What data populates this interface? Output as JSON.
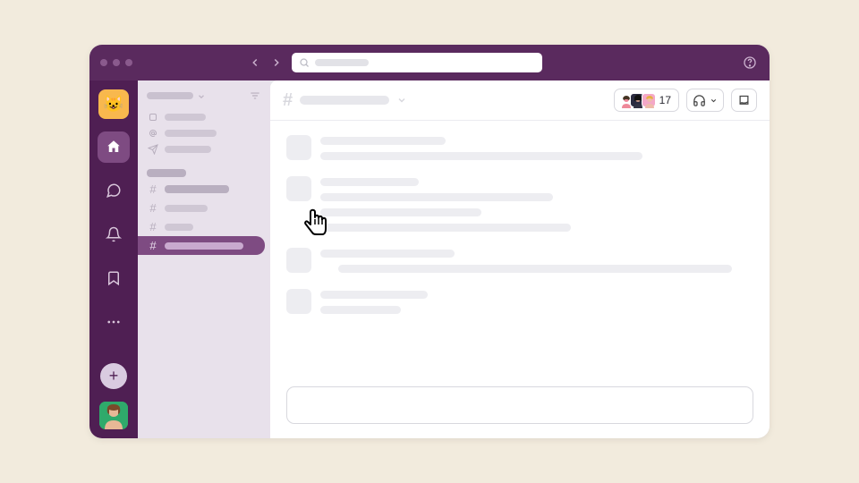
{
  "titlebar": {
    "search_placeholder": "",
    "help_tooltip": "Help"
  },
  "rail": {
    "workspace_emoji": "😺",
    "home_label": "Home",
    "dms_label": "DMs",
    "activity_label": "Activity",
    "later_label": "Later",
    "more_label": "More",
    "add_label": "+"
  },
  "sidebar": {
    "top_items": [
      "threads-icon",
      "mentions-icon",
      "drafts-icon"
    ],
    "channels": [
      {
        "name": "",
        "unread": true
      },
      {
        "name": "",
        "unread": false
      },
      {
        "name": "",
        "unread": false
      },
      {
        "name": "",
        "unread": false,
        "selected": true
      }
    ]
  },
  "channel": {
    "hash": "#",
    "name": "",
    "member_count": "17"
  },
  "composer": {
    "placeholder": ""
  },
  "colors": {
    "rail": "#4f1f53",
    "titlebar": "#5a2a5e",
    "accent": "#7e4b82",
    "workspace": "#f8b84e"
  }
}
